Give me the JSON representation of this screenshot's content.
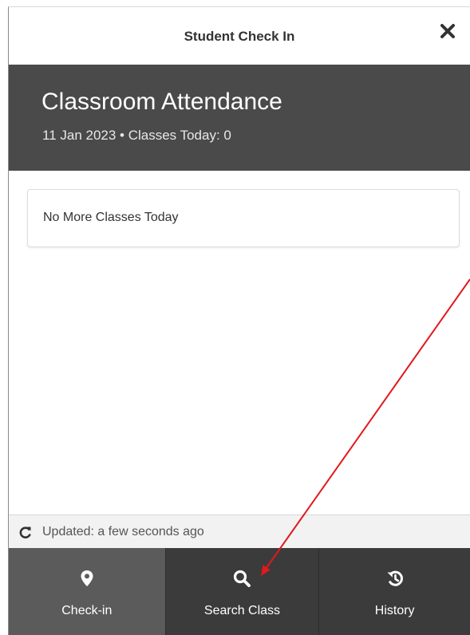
{
  "dialog": {
    "title": "Student Check In",
    "close_icon": "close-icon"
  },
  "header": {
    "title": "Classroom Attendance",
    "subtitle": "11 Jan 2023 • Classes Today: 0"
  },
  "content": {
    "message": "No More Classes Today"
  },
  "status": {
    "refresh_icon": "refresh-icon",
    "text": "Updated: a few seconds ago"
  },
  "bottom_nav": {
    "items": [
      {
        "label": "Check-in",
        "icon": "map-marker-icon",
        "active": true
      },
      {
        "label": "Search Class",
        "icon": "search-icon",
        "active": false
      },
      {
        "label": "History",
        "icon": "history-icon",
        "active": false
      }
    ]
  },
  "colors": {
    "header_bg": "#4a4a4a",
    "nav_bg": "#3b3b3b",
    "nav_active_bg": "#5b5b5b",
    "annotation_arrow": "#e0191f"
  }
}
